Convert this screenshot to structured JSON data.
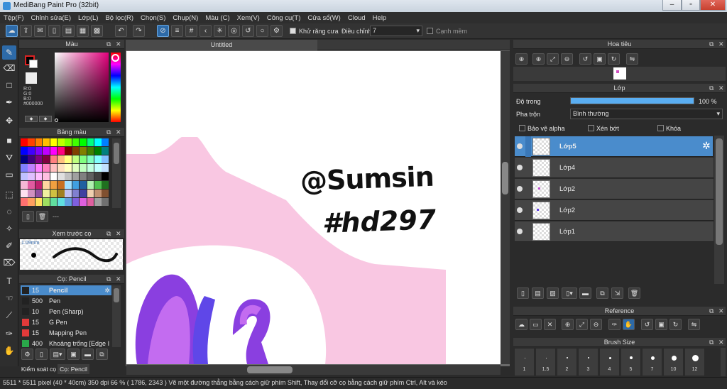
{
  "window": {
    "title": "MediBang Paint Pro (32bit)"
  },
  "menu": [
    "Tệp(F)",
    "Chỉnh sửa(E)",
    "Lớp(L)",
    "Bộ lọc(R)",
    "Chọn(S)",
    "Chụp(N)",
    "Màu (C)",
    "Xem(V)",
    "Công cụ(T)",
    "Cửa sổ(W)",
    "Cloud",
    "Help"
  ],
  "toolbar": {
    "antialias_label": "Khử răng cưa",
    "correction_label": "Điều chỉnh",
    "correction_value": "7",
    "smooth_label": "Cạnh mềm"
  },
  "color_panel": {
    "title": "Màu",
    "r": "R:0",
    "g": "G:0",
    "b": "B:0",
    "hex": "#000000",
    "fg_color": "#000000",
    "bg_color": "#ffffff"
  },
  "palette_panel": {
    "title": "Bảng màu",
    "footer_text": "---"
  },
  "preview_panel": {
    "title": "Xem trước cọ",
    "size_text": "1.09mm"
  },
  "brush_panel": {
    "title": "Cọ: Pencil",
    "items": [
      {
        "size": "15",
        "name": "Pencil",
        "color": "#222222",
        "selected": true
      },
      {
        "size": "500",
        "name": "Pen",
        "color": "#222222",
        "selected": false
      },
      {
        "size": "10",
        "name": "Pen (Sharp)",
        "color": "#222222",
        "selected": false
      },
      {
        "size": "15",
        "name": "G Pen",
        "color": "#e23a3a",
        "selected": false
      },
      {
        "size": "15",
        "name": "Mapping Pen",
        "color": "#e23a3a",
        "selected": false
      },
      {
        "size": "400",
        "name": "Khoảng trống [Edge I",
        "color": "#2aa84a",
        "selected": false
      }
    ],
    "tabs": [
      "Kiểm soát cọ",
      "Cọ: Pencil"
    ]
  },
  "canvas": {
    "tab_title": "Untitled",
    "sig_line1": "@Sumsin",
    "sig_line2": "#hd297"
  },
  "navigator": {
    "title": "Hoa tiêu"
  },
  "layer_panel": {
    "title": "Lớp",
    "opacity_label": "Độ trong",
    "opacity_value": "100 %",
    "opacity": 1.0,
    "blend_label": "Pha trộn",
    "blend_value": "Bình thường",
    "protect_alpha": "Bảo vệ alpha",
    "clipping": "Xén bớt",
    "lock": "Khóa",
    "layers": [
      {
        "name": "Lớp5",
        "selected": true
      },
      {
        "name": "Lớp4",
        "selected": false
      },
      {
        "name": "Lớp2",
        "selected": false
      },
      {
        "name": "Lớp2",
        "selected": false
      },
      {
        "name": "Lớp1",
        "selected": false
      }
    ]
  },
  "reference_panel": {
    "title": "Reference"
  },
  "brush_size_panel": {
    "title": "Brush Size",
    "sizes": [
      "1",
      "1.5",
      "2",
      "3",
      "4",
      "5",
      "7",
      "10",
      "12"
    ]
  },
  "status": {
    "text": "5511 * 5511 pixel  (40 * 40cm)  350 dpi  66 %  ( 1786, 2343 )  Vẽ một đường thẳng bằng cách giữ phím Shift, Thay đổi cỡ cọ bằng cách giữ phím Ctrl, Alt và kéo"
  }
}
